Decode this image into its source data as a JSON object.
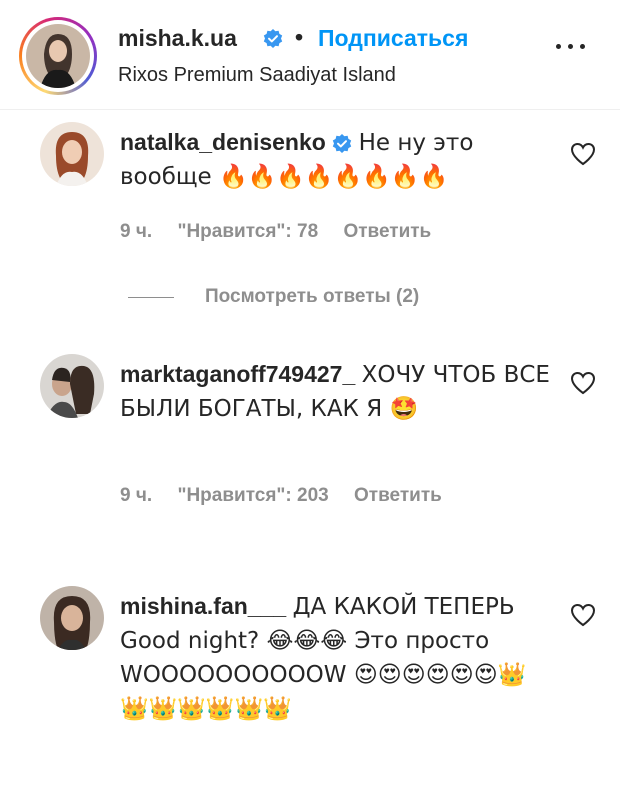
{
  "header": {
    "username": "misha.k.ua",
    "dot": "•",
    "follow_label": "Подписаться",
    "location": "Rixos Premium Saadiyat Island"
  },
  "comments": [
    {
      "username": "natalka_denisenko",
      "verified": true,
      "text": "Не ну это вообще 🔥🔥🔥🔥🔥🔥🔥🔥",
      "time": "9 ч.",
      "likes": "\"Нравится\": 78",
      "reply_label": "Ответить",
      "view_replies": "Посмотреть ответы (2)"
    },
    {
      "username": "marktaganoff749427_",
      "verified": false,
      "text": "ХОЧУ ЧТОБ ВСЕ БЫЛИ БОГАТЫ, КАК Я 🤩",
      "time": "9 ч.",
      "likes": "\"Нравится\": 203",
      "reply_label": "Ответить"
    },
    {
      "username": "mishina.fan___",
      "verified": false,
      "text": "ДА КАКОЙ ТЕПЕРЬ Good night? 😂😂😂 Это просто WOOOOOOOOOOW 😍😍😍😍😍😍👑👑👑👑👑👑👑"
    }
  ],
  "colors": {
    "text": "#262626",
    "muted": "#8e8e8e",
    "link_blue": "#0095f6",
    "verified_blue": "#3897f0"
  },
  "icons": {
    "verified": "verified-badge-icon",
    "more": "more-options-icon",
    "like": "heart-outline-icon"
  }
}
